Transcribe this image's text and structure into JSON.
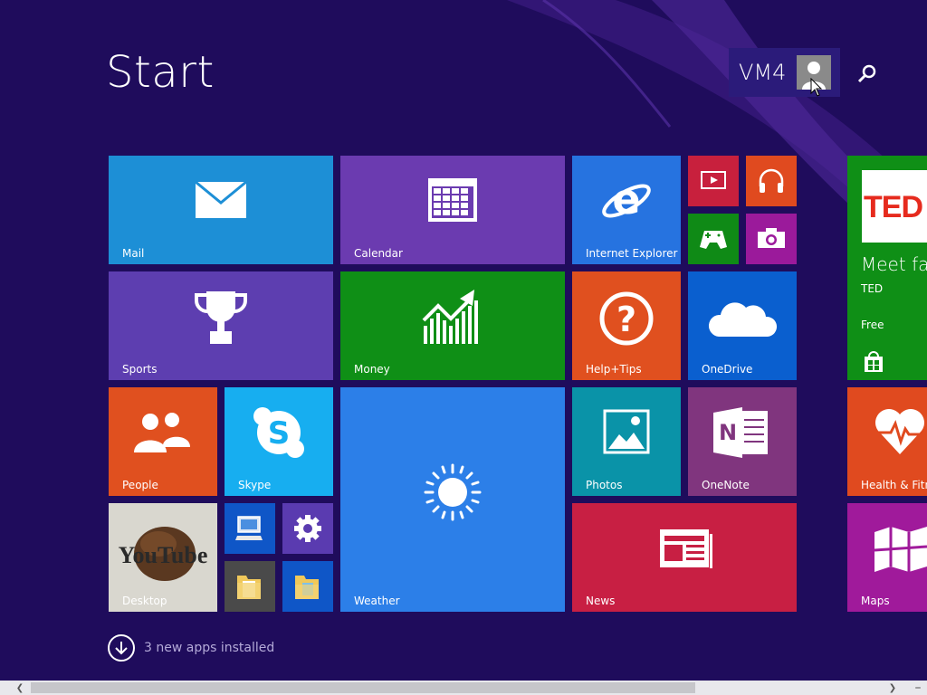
{
  "screen": {
    "title": "Start"
  },
  "user": {
    "name": "VM4"
  },
  "colors": {
    "background": "#1f0c5c",
    "mail": "#1d8fd6",
    "calendar": "#6b3bb0",
    "ie": "#2673e0",
    "video": "#c8203d",
    "music": "#e04a1f",
    "games": "#0f8a16",
    "camera": "#9b1a9b",
    "ted": "#0f8f16",
    "sports": "#5d3eb0",
    "money": "#0f8f16",
    "help": "#e0501f",
    "onedrive": "#0a5fcf",
    "people": "#e0501f",
    "skype": "#17aef0",
    "weather": "#2c7fe8",
    "photos": "#0a93a8",
    "onenote": "#80357e",
    "health": "#e04a1f",
    "news": "#c81f43",
    "maps": "#a01a9b",
    "desktop": "#d8d8d8",
    "small_blue": "#0f56c7",
    "settings": "#5a3bb0",
    "folder_tile": "#4a4a4a"
  },
  "tiles": {
    "mail": {
      "label": "Mail",
      "icon": "envelope-icon"
    },
    "calendar": {
      "label": "Calendar",
      "icon": "calendar-icon"
    },
    "ie": {
      "label": "Internet Explorer",
      "icon": "internet-explorer-icon"
    },
    "video": {
      "icon": "video-icon"
    },
    "music": {
      "icon": "headphones-icon"
    },
    "games": {
      "icon": "gamepad-icon"
    },
    "camera": {
      "icon": "camera-icon"
    },
    "ted": {
      "logo": "TED",
      "headline": "Meet fas",
      "publisher": "TED",
      "price": "Free",
      "icon": "store-icon"
    },
    "sports": {
      "label": "Sports",
      "icon": "trophy-icon"
    },
    "money": {
      "label": "Money",
      "icon": "chart-icon"
    },
    "help": {
      "label": "Help+Tips",
      "icon": "question-icon"
    },
    "onedrive": {
      "label": "OneDrive",
      "icon": "cloud-icon"
    },
    "people": {
      "label": "People",
      "icon": "people-icon"
    },
    "skype": {
      "label": "Skype",
      "icon": "skype-icon"
    },
    "weather": {
      "label": "Weather",
      "icon": "sun-icon"
    },
    "photos": {
      "label": "Photos",
      "icon": "picture-icon"
    },
    "onenote": {
      "label": "OneNote",
      "icon": "onenote-icon"
    },
    "health": {
      "label": "Health & Fitne",
      "icon": "heart-pulse-icon"
    },
    "desktop": {
      "label": "Desktop",
      "image_text": "YouTube"
    },
    "computer": {
      "icon": "computer-icon"
    },
    "settings": {
      "icon": "gear-icon"
    },
    "folder1": {
      "icon": "folder-icon"
    },
    "folder2": {
      "icon": "folder-icon"
    },
    "news": {
      "label": "News",
      "icon": "newspaper-icon"
    },
    "maps": {
      "label": "Maps",
      "icon": "map-icon"
    }
  },
  "notice": {
    "text": "3 new apps installed"
  }
}
